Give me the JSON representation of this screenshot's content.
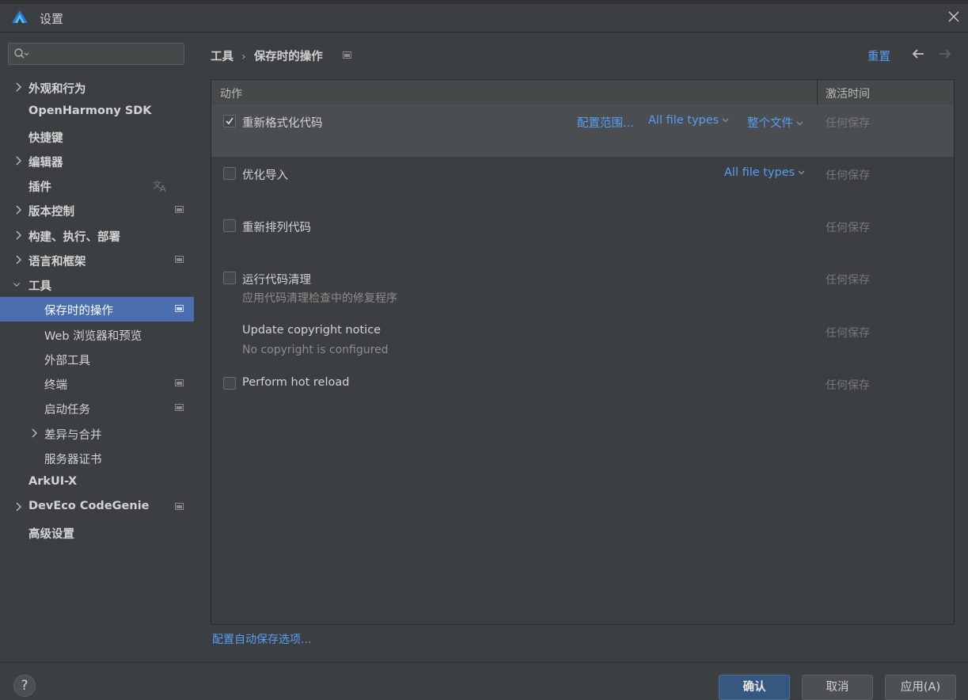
{
  "window": {
    "title": "设置"
  },
  "search": {
    "placeholder": ""
  },
  "sidebar": {
    "items": [
      {
        "label": "外观和行为"
      },
      {
        "label": "OpenHarmony SDK"
      },
      {
        "label": "快捷键"
      },
      {
        "label": "编辑器"
      },
      {
        "label": "插件"
      },
      {
        "label": "版本控制"
      },
      {
        "label": "构建、执行、部署"
      },
      {
        "label": "语言和框架"
      },
      {
        "label": "工具"
      },
      {
        "label": "保存时的操作"
      },
      {
        "label": "Web 浏览器和预览"
      },
      {
        "label": "外部工具"
      },
      {
        "label": "终端"
      },
      {
        "label": "启动任务"
      },
      {
        "label": "差异与合并"
      },
      {
        "label": "服务器证书"
      },
      {
        "label": "ArkUI-X"
      },
      {
        "label": "DevEco CodeGenie"
      },
      {
        "label": "高级设置"
      }
    ]
  },
  "header": {
    "breadcrumb_parent": "工具",
    "breadcrumb_separator": "›",
    "breadcrumb_current": "保存时的操作",
    "reset_label": "重置"
  },
  "table": {
    "col_action": "动作",
    "col_activation": "激活时间",
    "rows": [
      {
        "label": "重新格式化代码",
        "checked": true,
        "scope_link": "配置范围...",
        "types_link": "All file types",
        "file_link": "整个文件",
        "activation": "任何保存"
      },
      {
        "label": "优化导入",
        "checked": false,
        "types_link": "All file types",
        "activation": "任何保存"
      },
      {
        "label": "重新排列代码",
        "checked": false,
        "activation": "任何保存"
      },
      {
        "label": "运行代码清理",
        "checked": false,
        "sublabel": "应用代码清理检查中的修复程序",
        "activation": "任何保存"
      },
      {
        "label": "Update copyright notice",
        "sublabel": "No copyright is configured",
        "activation": "任何保存"
      },
      {
        "label": "Perform hot reload",
        "checked": false,
        "activation": "任何保存"
      }
    ]
  },
  "autosave_link": "配置自动保存选项...",
  "footer": {
    "help_label": "?",
    "ok_label": "确认",
    "cancel_label": "取消",
    "apply_label": "应用(A)"
  },
  "colors": {
    "accent": "#4b6eaf",
    "link": "#589df6",
    "background": "#3c3f41"
  }
}
